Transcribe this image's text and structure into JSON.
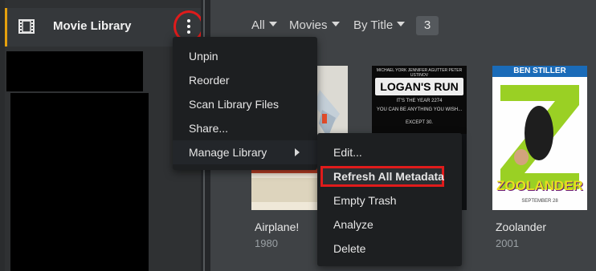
{
  "sidebar": {
    "library_label": "Movie Library",
    "icon": "film-icon",
    "more_icon": "vertical-ellipsis-icon"
  },
  "toolbar": {
    "filter_all": "All",
    "filter_type": "Movies",
    "filter_sort": "By Title",
    "count": "3"
  },
  "posters": [
    {
      "title": "Airplane!",
      "year": "1980"
    },
    {
      "title": "",
      "year": "",
      "poster_lines": [
        "MICHAEL YORK   JENNIFER AGUTTER   PETER USTINOV",
        "LOGAN'S RUN",
        "IT'S THE YEAR 2274",
        "YOU CAN BE ANYTHING YOU WISH...",
        "EXCEPT 30."
      ]
    },
    {
      "title": "Zoolander",
      "year": "2001",
      "poster_lines": [
        "BEN STILLER",
        "ZOOLANDER",
        "SEPTEMBER 28"
      ]
    }
  ],
  "library_menu": {
    "items": [
      "Unpin",
      "Reorder",
      "Scan Library Files",
      "Share...",
      "Manage Library"
    ]
  },
  "manage_submenu": {
    "items": [
      "Edit...",
      "Refresh All Metadata",
      "Empty Trash",
      "Analyze",
      "Delete"
    ]
  },
  "colors": {
    "accent": "#e5a00d",
    "annotation_red": "#e01b1b",
    "sidebar_bg": "#2f3133",
    "content_bg": "#3f4245",
    "menu_bg": "#1d1f21"
  }
}
